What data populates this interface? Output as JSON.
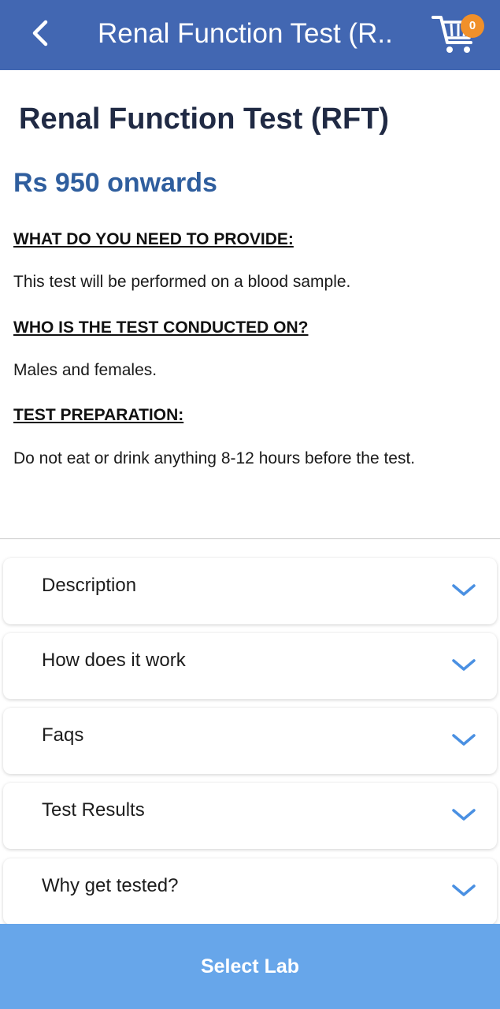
{
  "header": {
    "title": "Renal Function Test (R..",
    "cart_count": "0",
    "colors": {
      "bar": "#4267b2",
      "badge": "#f0902a"
    }
  },
  "test": {
    "name": "Renal Function Test (RFT)",
    "price": "Rs 950 onwards"
  },
  "sections": [
    {
      "heading": "WHAT DO YOU NEED TO PROVIDE:",
      "text": "This test will be performed on a blood sample."
    },
    {
      "heading": "WHO IS THE TEST CONDUCTED ON?",
      "text": "Males and females."
    },
    {
      "heading": "TEST PREPARATION:",
      "text": "Do not eat or drink anything 8-12 hours before the test."
    }
  ],
  "accordions": [
    {
      "label": "Description",
      "icon": "chevron-down-icon"
    },
    {
      "label": "How does it work",
      "icon": "chevron-down-icon"
    },
    {
      "label": "Faqs",
      "icon": "chevron-down-icon"
    },
    {
      "label": "Test Results",
      "icon": "chevron-down-icon"
    },
    {
      "label": "Why get tested?",
      "icon": "chevron-down-icon"
    }
  ],
  "footer": {
    "button_label": "Select Lab",
    "color": "#67a6ea"
  }
}
